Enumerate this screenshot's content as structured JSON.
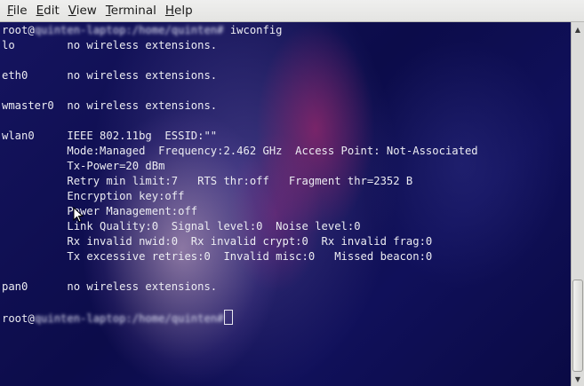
{
  "menu": {
    "items": [
      {
        "mnemonic": "F",
        "rest": "ile"
      },
      {
        "mnemonic": "E",
        "rest": "dit"
      },
      {
        "mnemonic": "V",
        "rest": "iew"
      },
      {
        "mnemonic": "T",
        "rest": "erminal"
      },
      {
        "mnemonic": "H",
        "rest": "elp"
      }
    ]
  },
  "terminal": {
    "prompt_user": "root@",
    "prompt_host_blurred": "quinten-laptop:/home/quinten#",
    "command": " iwconfig",
    "lines": [
      "lo        no wireless extensions.",
      "",
      "eth0      no wireless extensions.",
      "",
      "wmaster0  no wireless extensions.",
      "",
      "wlan0     IEEE 802.11bg  ESSID:\"\"",
      "          Mode:Managed  Frequency:2.462 GHz  Access Point: Not-Associated",
      "          Tx-Power=20 dBm",
      "          Retry min limit:7   RTS thr:off   Fragment thr=2352 B",
      "          Encryption key:off",
      "          Power Management:off",
      "          Link Quality:0  Signal level:0  Noise level:0",
      "          Rx invalid nwid:0  Rx invalid crypt:0  Rx invalid frag:0",
      "          Tx excessive retries:0  Invalid misc:0   Missed beacon:0",
      "",
      "pan0      no wireless extensions.",
      ""
    ],
    "final_prompt_user": "root@",
    "final_prompt_host_blurred": "quinten-laptop:/home/quinten#"
  },
  "colors": {
    "terminal_bg": "#0c0c4a",
    "terminal_fg": "#ececf2",
    "menubar_bg": "#e8e8e7"
  }
}
